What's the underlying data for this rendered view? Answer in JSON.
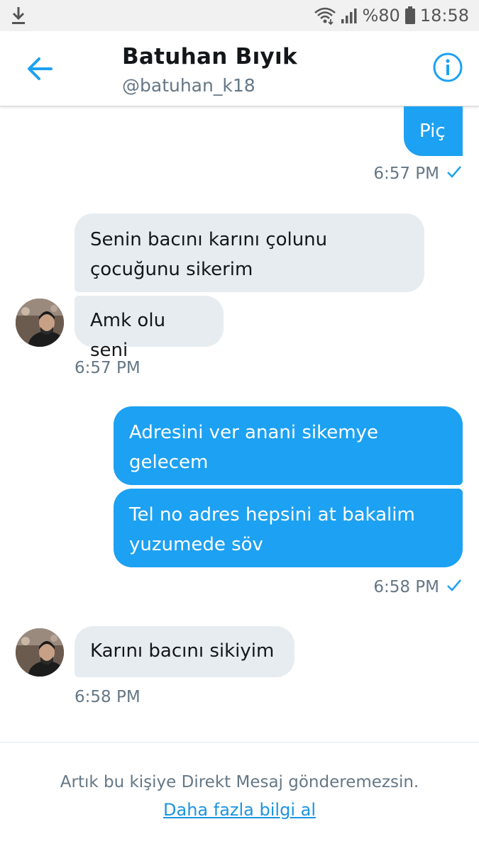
{
  "status_bar": {
    "battery_percent": "%80",
    "time": "18:58",
    "icons": [
      "download-icon",
      "wifi-icon",
      "signal-icon",
      "battery-icon"
    ]
  },
  "header": {
    "name": "Batuhan Bıyık",
    "handle": "@batuhan_k18",
    "back_icon": "arrow-left-icon",
    "info_icon": "info-icon"
  },
  "messages": [
    {
      "direction": "sent",
      "text": "Piç"
    },
    {
      "direction": "sent_timestamp",
      "text": "6:57 PM"
    },
    {
      "direction": "received",
      "text": "Senin bacını karını çolunu çocuğunu sikerim"
    },
    {
      "direction": "received",
      "text": "Amk olu seni"
    },
    {
      "direction": "received_timestamp",
      "text": "6:57 PM"
    },
    {
      "direction": "sent",
      "text": "Adresini ver anani sikemye gelecem"
    },
    {
      "direction": "sent",
      "text": "Tel no adres hepsini at bakalim yuzumede söv"
    },
    {
      "direction": "sent_timestamp",
      "text": "6:58 PM"
    },
    {
      "direction": "received",
      "text": "Karını bacını sikiyim"
    },
    {
      "direction": "received_timestamp",
      "text": "6:58 PM"
    }
  ],
  "footer": {
    "notice": "Artık bu kişiye Direkt Mesaj gönderemezsin.",
    "link": "Daha fazla bilgi al"
  },
  "colors": {
    "accent": "#1da1f2",
    "received_bubble": "#e6ecf0",
    "muted_text": "#657786"
  }
}
